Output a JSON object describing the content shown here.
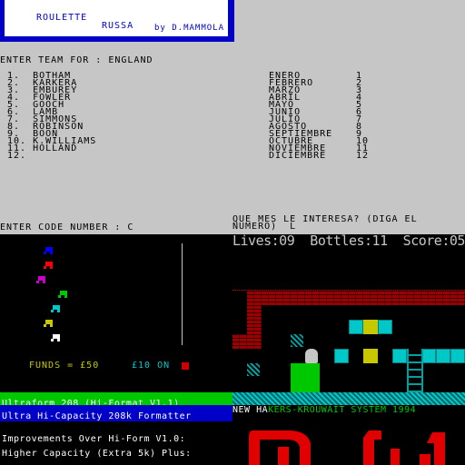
{
  "title_box": {
    "line1": "ROULETTE",
    "line2": "RUSSA",
    "author": "by D.MAMMOLA"
  },
  "team_prompt": "ENTER TEAM FOR : ENGLAND",
  "team_list": [
    "1.  BOTHAM",
    "2.  KARKERA",
    "3.  EMBUREY",
    "4.  FOWLER",
    "5.  GOOCH",
    "6.  LAMB",
    "7.  SIMMONS",
    "8.  ROBINSON",
    "9.  BOON",
    "10. K.WILLIAMS",
    "11. HOLLAND",
    "12."
  ],
  "months": [
    {
      "name": "ENERO",
      "num": "1"
    },
    {
      "name": "FEBRERO",
      "num": "2"
    },
    {
      "name": "MARZO",
      "num": "3"
    },
    {
      "name": "ABRIL",
      "num": "4"
    },
    {
      "name": "MAYO",
      "num": "5"
    },
    {
      "name": "JUNIO",
      "num": "6"
    },
    {
      "name": "JULIO",
      "num": "7"
    },
    {
      "name": "AGOSTO",
      "num": "8"
    },
    {
      "name": "SEPTIEMBRE",
      "num": "9"
    },
    {
      "name": "OCTUBRE",
      "num": "10"
    },
    {
      "name": "NOVIEMBRE",
      "num": "11"
    },
    {
      "name": "DICIEMBRE",
      "num": "12"
    }
  ],
  "code_prompt": "ENTER CODE NUMBER : C",
  "month_question_1": "QUE MES LE INTERESA? (DIGA EL",
  "month_question_2": "NUMERO)  L",
  "roulette": {
    "funds": "FUNDS = £50",
    "bet": "£10 ON",
    "horse_colors": [
      "#0000ff",
      "#ff0000",
      "#c800c8",
      "#00c800",
      "#00c8c8",
      "#c8c800",
      "#ffffff"
    ]
  },
  "game_hud": "Lives:09  Bottles:11  Score:05",
  "utility": {
    "line1": "Ultraform 208 (Hi-Format V1.1)",
    "line2": "Ultra Hi-Capacity 208k Formatter",
    "line3": "Improvements Over Hi-Form V1.0:",
    "line4": "Higher Capacity (Extra 5k) Plus:"
  },
  "banner": {
    "white": "NEW HA",
    "green": "KERS-KROUWAIT SYSTEM 1994"
  }
}
